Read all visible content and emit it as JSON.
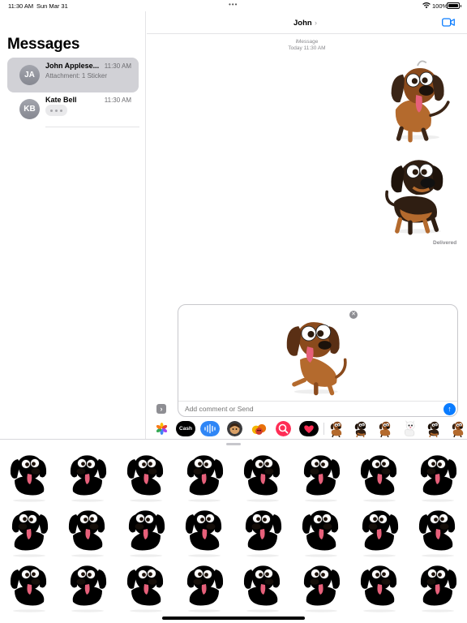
{
  "status_bar": {
    "time": "11:30 AM",
    "date": "Sun Mar 31",
    "battery": "100%"
  },
  "sidebar": {
    "title": "Messages",
    "conversations": [
      {
        "initials": "JA",
        "name": "John Applese...",
        "time": "11:30 AM",
        "preview": "Attachment: 1 Sticker",
        "selected": true
      },
      {
        "initials": "KB",
        "name": "Kate Bell",
        "time": "11:30 AM",
        "preview": "",
        "typing": true
      }
    ]
  },
  "chat": {
    "contact": "John",
    "service": "iMessage",
    "timestamp": "Today 11:30 AM",
    "delivered": "Delivered",
    "messages": [
      {
        "type": "sticker",
        "sticker": "dachshund-wide-eyes"
      },
      {
        "type": "sticker",
        "sticker": "dachshund-cross-eyed"
      }
    ]
  },
  "compose": {
    "placeholder": "Add comment or Send",
    "attached_sticker": "dachshund-tongue-out"
  },
  "app_drawer": {
    "apps": [
      "Photos",
      "Cash",
      "Audio",
      "Memoji",
      "Memoji Stickers",
      "Search",
      "Digital Touch"
    ],
    "cash_label": "Cash"
  },
  "sticker_panel": {
    "rows": 3,
    "columns": 8
  },
  "colors": {
    "accent": "#0a7cff",
    "dog_body": "#b46a2d",
    "dog_dark": "#3b2516",
    "selected_row": "#d1d1d6"
  }
}
